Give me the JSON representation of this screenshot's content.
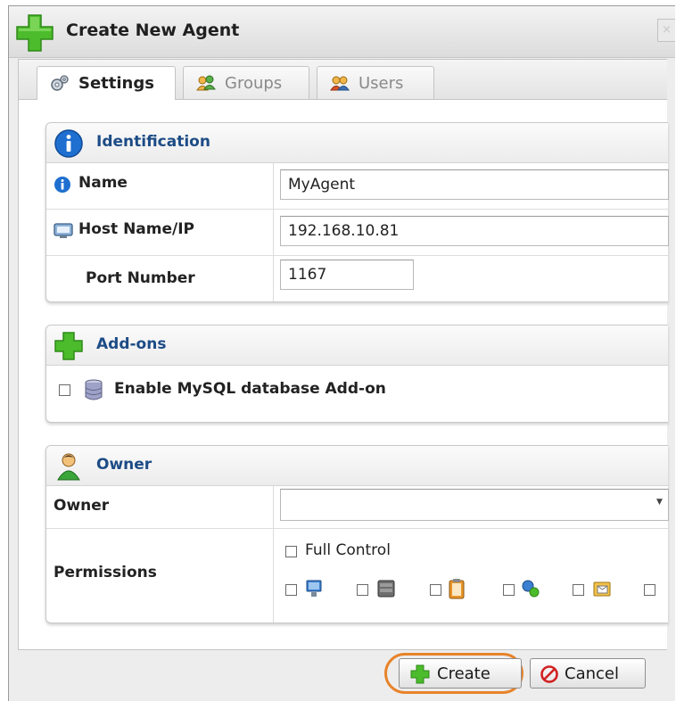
{
  "dialog": {
    "title": "Create New Agent",
    "close_label": "×"
  },
  "tabs": [
    {
      "label": "Settings",
      "active": true
    },
    {
      "label": "Groups",
      "active": false
    },
    {
      "label": "Users",
      "active": false
    }
  ],
  "identification": {
    "title": "Identification",
    "name_label": "Name",
    "name_value": "MyAgent",
    "host_label": "Host Name/IP",
    "host_value": "192.168.10.81",
    "port_label": "Port Number",
    "port_value": "1167"
  },
  "addons": {
    "title": "Add-ons",
    "mysql_label": "Enable MySQL database Add-on",
    "mysql_checked": false
  },
  "owner_section": {
    "title": "Owner",
    "owner_label": "Owner",
    "owner_value": "",
    "permissions_label": "Permissions",
    "full_control_label": "Full Control",
    "full_control_checked": false,
    "permission_icons": [
      "computer-icon",
      "server-icon",
      "clipboard-icon",
      "network-icon",
      "mail-folder-icon"
    ]
  },
  "footer": {
    "create_label": "Create",
    "cancel_label": "Cancel"
  },
  "colors": {
    "section_title": "#1d4c86",
    "highlight": "#e8832a",
    "plus_green": "#4cbb2c",
    "cancel_red": "#d22020"
  }
}
